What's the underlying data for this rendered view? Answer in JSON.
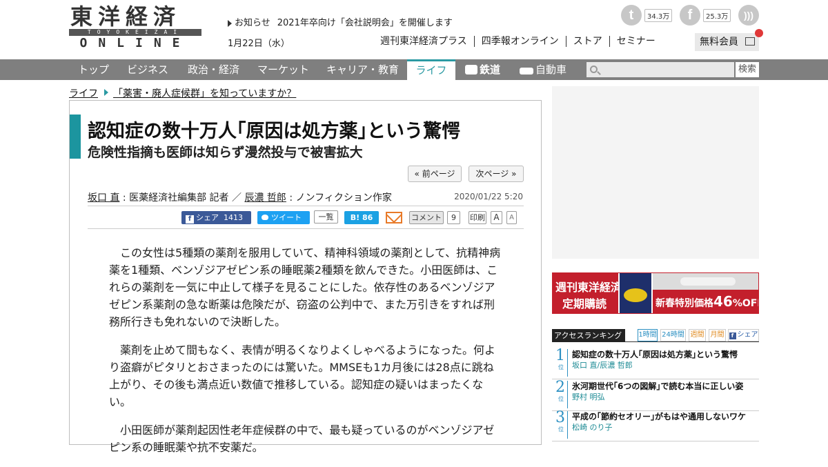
{
  "header": {
    "logo_kanji": "東洋経済",
    "logo_band": "TOYOKEIZAI",
    "logo_online": "ONLINE",
    "notice_label": "お知らせ",
    "notice_text": "2021年卒向け「会社説明会」を開催します",
    "date": "1月22日（水）",
    "twitter_count": "34.3万",
    "facebook_count": "25.3万",
    "links": [
      "週刊東洋経済プラス",
      "四季報オンライン",
      "ストア",
      "セミナー"
    ],
    "member_label": "無料会員"
  },
  "nav": {
    "items": [
      "トップ",
      "ビジネス",
      "政治・経済",
      "マーケット",
      "キャリア・教育",
      "ライフ",
      "鉄道",
      "自動車"
    ],
    "active": "ライフ",
    "search_button": "検索"
  },
  "breadcrumb": {
    "section": "ライフ",
    "series": "「薬害・廃人症候群」を知っていますか？"
  },
  "article": {
    "title": "認知症の数十万人｢原因は処方薬｣という驚愕",
    "subtitle": "危険性指摘も医師は知らず漫然投与で被害拡大",
    "prev_label": "« 前ページ",
    "next_label": "次ページ »",
    "author1": "坂口 直",
    "author1_role": "医薬経済社編集部 記者",
    "separator": "／",
    "author2": "辰濃 哲郎",
    "author2_role": "ノンフィクション作家",
    "published": "2020/01/22 5:20",
    "share": {
      "facebook_label": "シェア",
      "facebook_count": "1413",
      "tweet_label": "ツイート",
      "list_label": "一覧",
      "hatena_count": "86",
      "comment_label": "コメント",
      "comment_count": "9",
      "print_label": "印刷",
      "font_plus": "A",
      "font_minus": "A"
    },
    "paragraphs": [
      "この女性は5種類の薬剤を服用していて、精神科領域の薬剤として、抗精神病薬を1種類、ベンゾジアゼピン系の睡眠薬2種類を飲んできた。小田医師は、これらの薬剤を一気に中止して様子を見ることにした。依存性のあるベンゾジアゼピン系薬剤の急な断薬は危険だが、窃盗の公判中で、また万引きをすれば刑務所行きも免れないので決断した。",
      "薬剤を止めて間もなく、表情が明るくなりよくしゃべるようになった。何より盗癖がピタリとおさまったのには驚いた。MMSEも1カ月後には28点に跳ね上がり、その後も満点近い数値で推移している。認知症の疑いはまったくない。",
      "小田医師が薬剤起因性老年症候群の中で、最も疑っているのがベンゾジアゼピン系の睡眠薬や抗不安薬だ。"
    ]
  },
  "sidebar": {
    "banner": {
      "line1": "週刊東洋経済",
      "line2": "定期購読",
      "offer_prefix": "新春特別価格",
      "offer_value": "46",
      "offer_suffix": "%OFF"
    },
    "ranking": {
      "title": "アクセスランキング",
      "tabs": [
        "1時間",
        "24時間",
        "週間",
        "月間",
        "シェア"
      ],
      "items": [
        {
          "rank": "1",
          "suffix": "位",
          "title": "認知症の数十万人｢原因は処方薬｣という驚愕",
          "author": "坂口 直/辰濃 哲郎"
        },
        {
          "rank": "2",
          "suffix": "位",
          "title": "氷河期世代｢6つの図解｣で読む本当に正しい姿",
          "author": "野村 明弘"
        },
        {
          "rank": "3",
          "suffix": "位",
          "title": "平成の｢節約セオリー｣がもはや通用しないワケ",
          "author": "松崎 のり子"
        }
      ]
    }
  },
  "colors": {
    "accent": "#1c959f",
    "nav_bg": "#7f7f7f",
    "banner_red": "#c31f2c",
    "rank_blue": "#2b8fc2"
  },
  "icons": [
    "twitter-icon",
    "facebook-icon",
    "rss-icon",
    "gift-icon",
    "train-icon",
    "car-icon",
    "search-icon",
    "mail-icon",
    "hatena-icon"
  ]
}
